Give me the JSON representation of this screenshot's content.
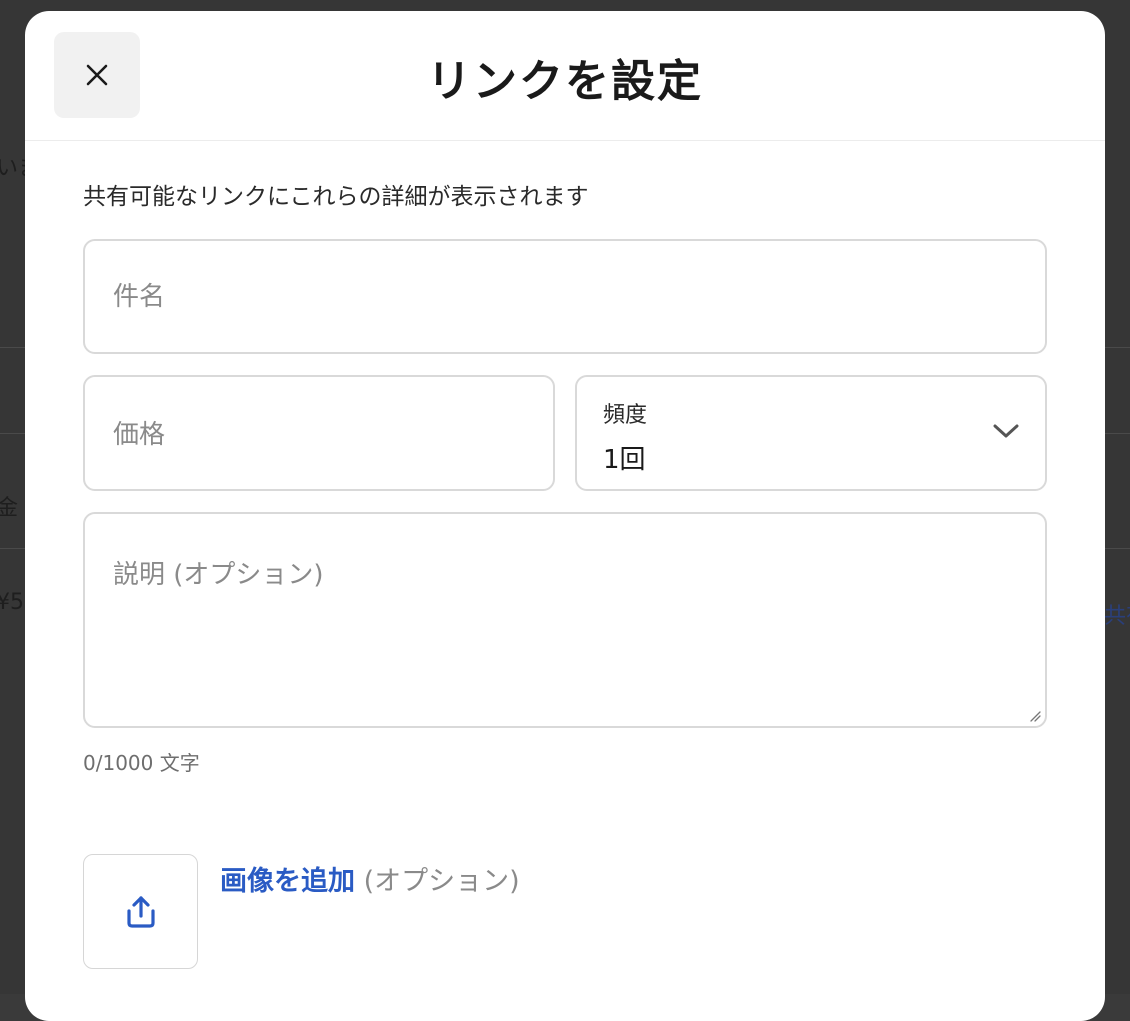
{
  "background": {
    "fragment_1": "いま",
    "fragment_2": "金",
    "fragment_3": "¥5",
    "fragment_4": "共有"
  },
  "modal": {
    "title": "リンクを設定",
    "close_icon": "close-icon",
    "intro_text": "共有可能なリンクにこれらの詳細が表示されます",
    "name_field": {
      "placeholder": "件名",
      "value": ""
    },
    "price_field": {
      "placeholder": "価格",
      "value": ""
    },
    "frequency_field": {
      "label": "頻度",
      "value": "1回",
      "icon": "chevron-down-icon"
    },
    "description_field": {
      "placeholder": "説明 (オプション)",
      "value": ""
    },
    "char_counter": "0/1000 文字",
    "image_upload": {
      "icon": "upload-icon",
      "link_label": "画像を追加",
      "optional_label": "(オプション)"
    }
  },
  "colors": {
    "accent": "#2a5bc4",
    "backdrop": "#363636",
    "field_border": "#d9d9d9",
    "close_button_bg": "#f1f1f1"
  }
}
